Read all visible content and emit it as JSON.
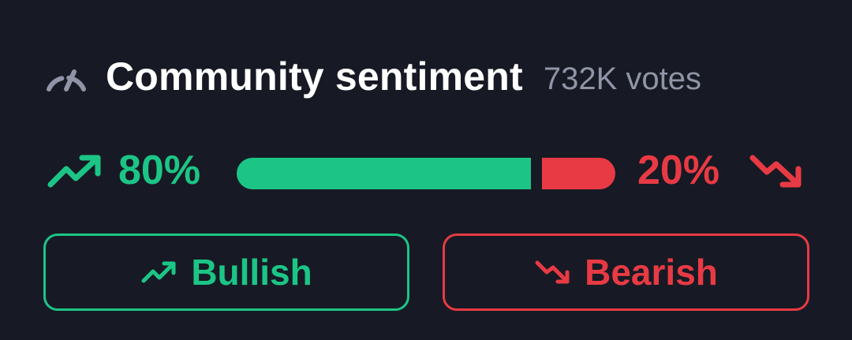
{
  "header": {
    "icon": "gauge-icon",
    "title": "Community sentiment",
    "votes": "732K votes"
  },
  "sentiment": {
    "bullish_percent_label": "80%",
    "bearish_percent_label": "20%",
    "bullish_fraction": 0.8,
    "bearish_fraction": 0.2
  },
  "buttons": {
    "bullish_label": "Bullish",
    "bearish_label": "Bearish"
  },
  "colors": {
    "background": "#171a24",
    "bullish": "#1cc586",
    "bearish": "#e83a44",
    "muted": "#8f95a6",
    "title": "#ffffff"
  },
  "icons": {
    "up": "trend-up-icon",
    "down": "trend-down-icon"
  }
}
